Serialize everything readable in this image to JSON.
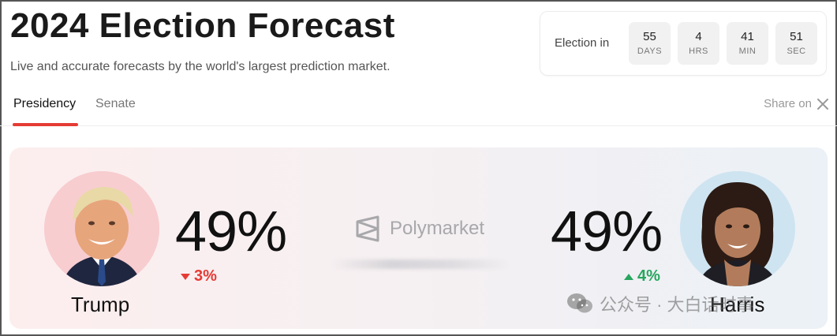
{
  "header": {
    "title": "2024 Election Forecast",
    "subtitle": "Live and accurate forecasts by the world's largest prediction market."
  },
  "countdown": {
    "label": "Election in",
    "units": [
      {
        "value": "55",
        "unit": "DAYS"
      },
      {
        "value": "4",
        "unit": "HRS"
      },
      {
        "value": "41",
        "unit": "MIN"
      },
      {
        "value": "51",
        "unit": "SEC"
      }
    ]
  },
  "tabs": {
    "active": "Presidency",
    "other": "Senate",
    "share_label": "Share on"
  },
  "candidates": {
    "trump": {
      "name": "Trump",
      "percent": "49%",
      "change": "3%",
      "direction": "down"
    },
    "harris": {
      "name": "Harris",
      "percent": "49%",
      "change": "4%",
      "direction": "up"
    }
  },
  "brand": {
    "name": "Polymarket"
  },
  "watermark": {
    "text": "公众号 · 大白话时事"
  },
  "colors": {
    "accent_red": "#e53b35",
    "accent_green": "#28a55f"
  }
}
